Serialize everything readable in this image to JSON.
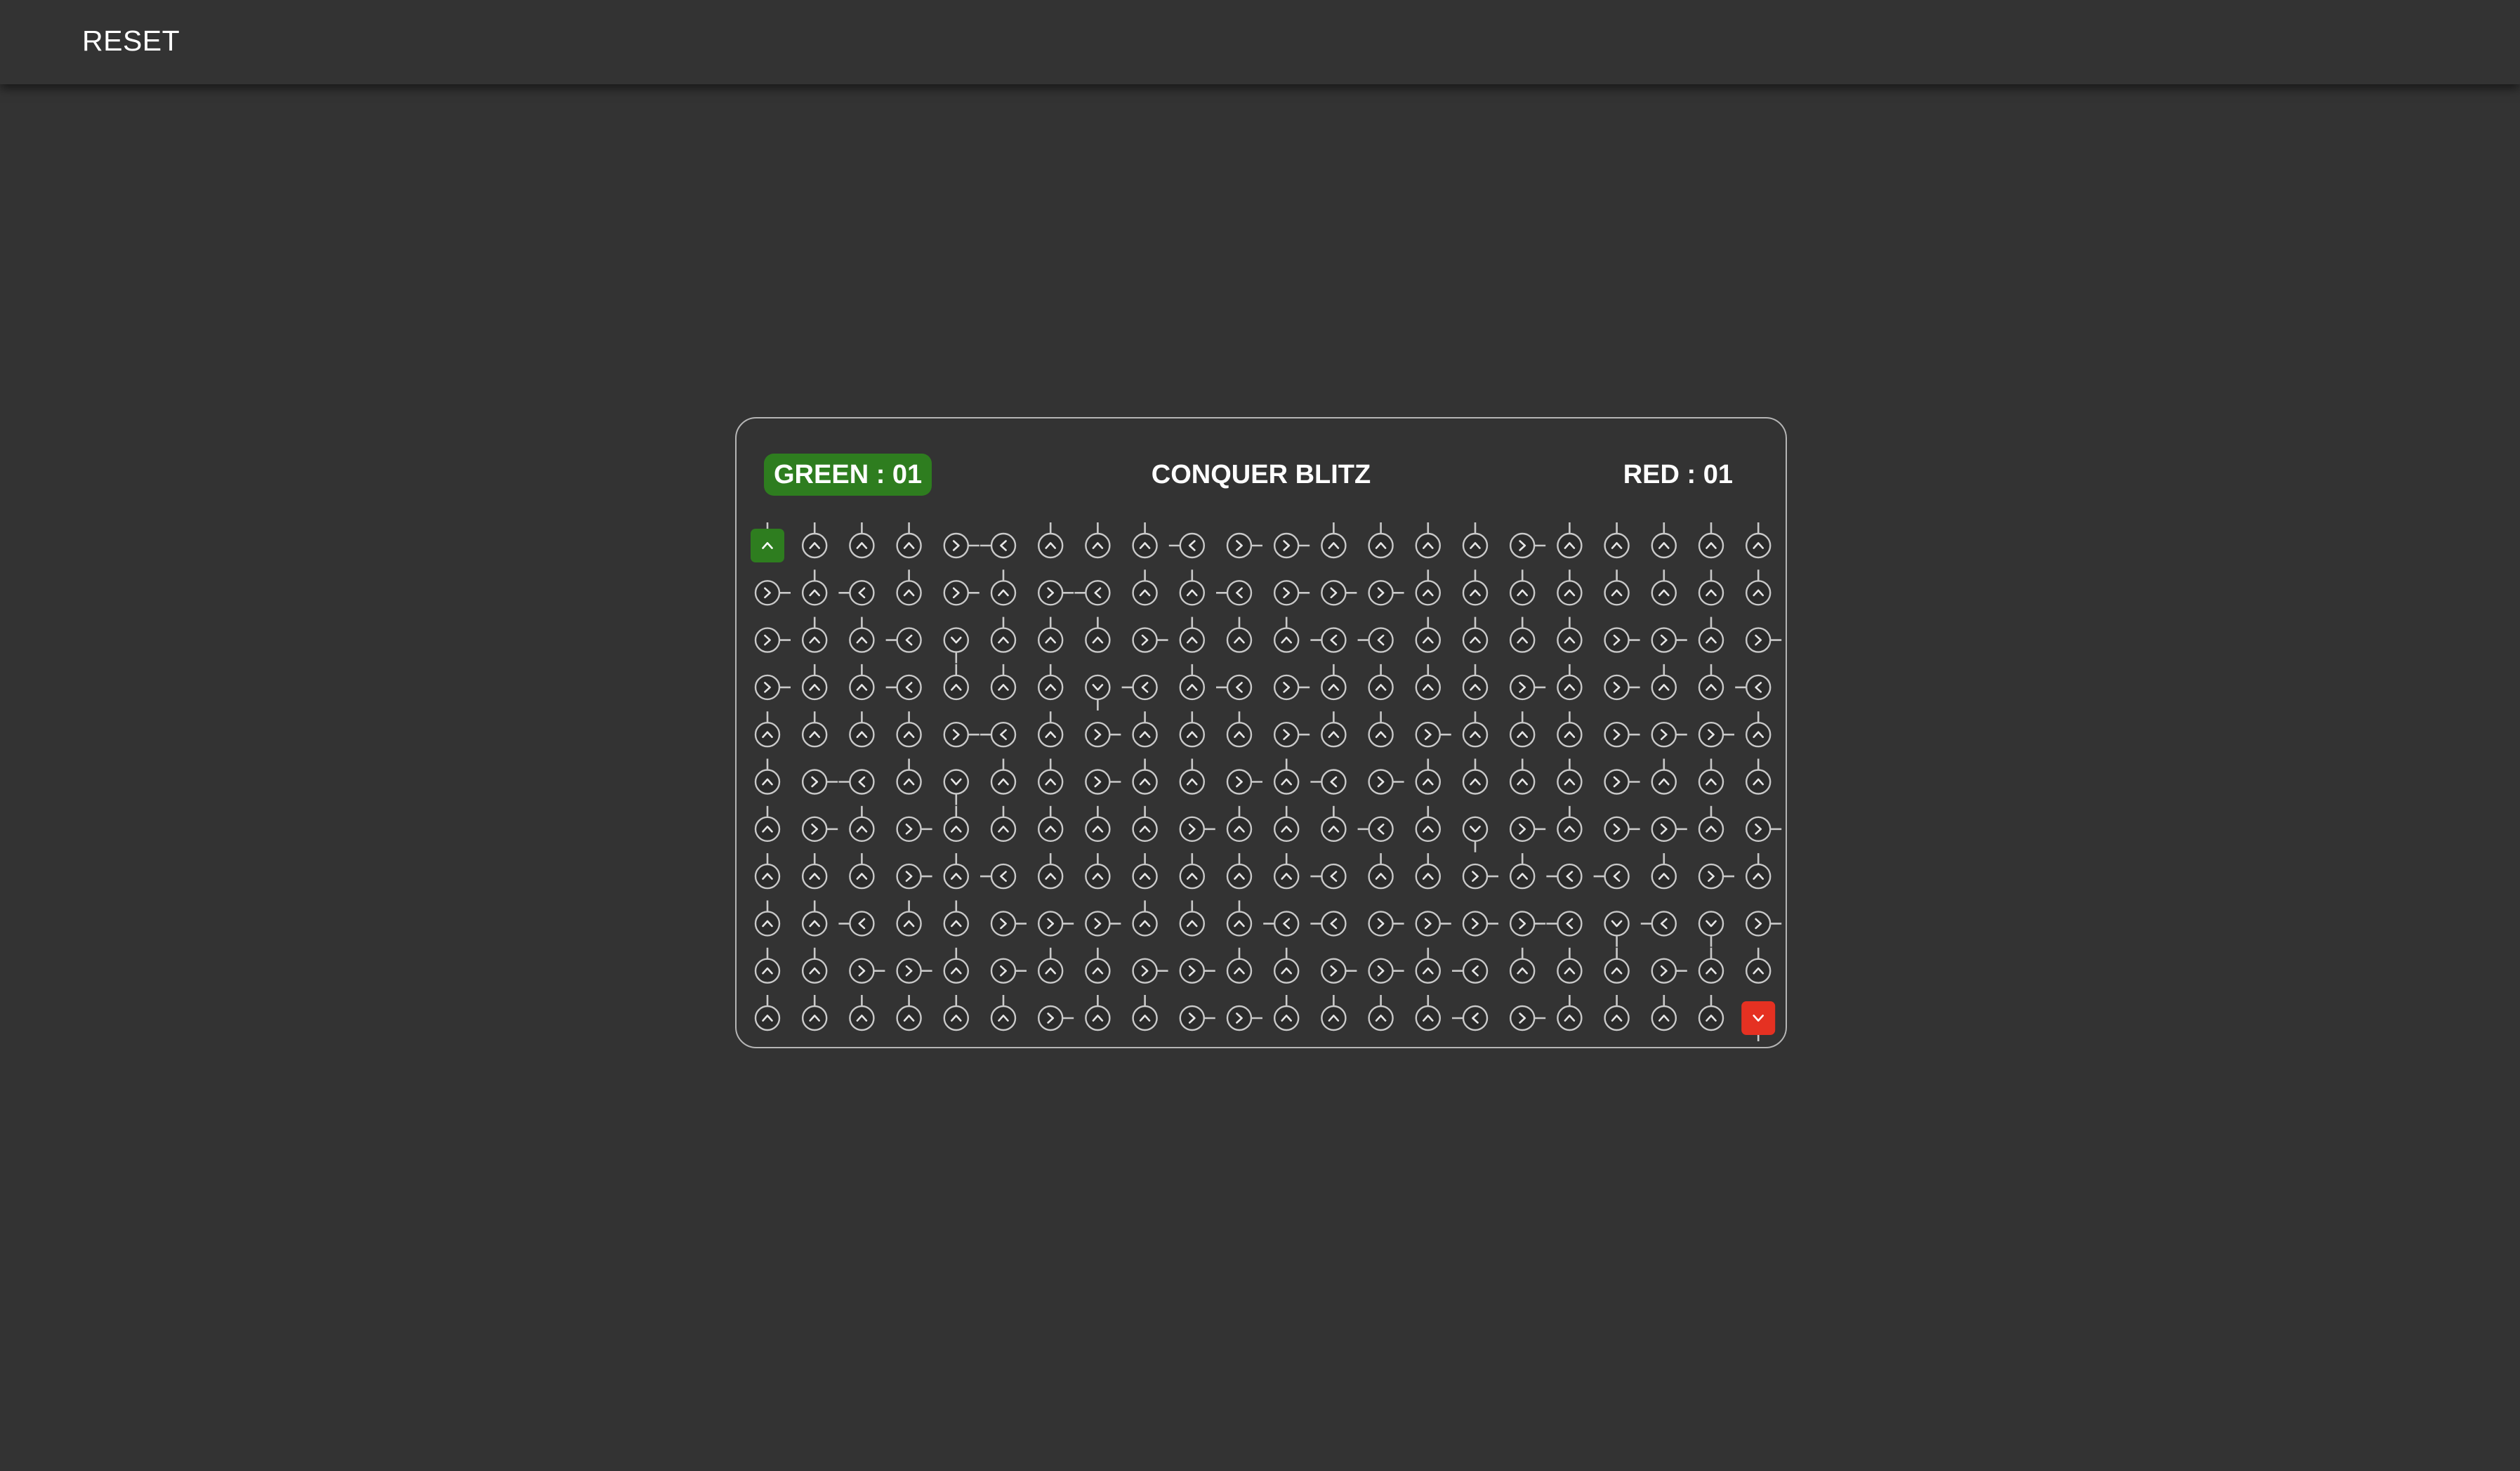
{
  "toolbar": {
    "reset_label": "RESET"
  },
  "game": {
    "title": "CONQUER BLITZ",
    "green_score": "GREEN : 01",
    "red_score": "RED : 01"
  },
  "colors": {
    "background": "#333333",
    "green_owner": "#2e7d1f",
    "red_owner": "#e53122",
    "node_stroke": "#c9c9c9",
    "panel_border": "#b5b5b5"
  },
  "legend": {
    "U": "up-arrow-icon",
    "D": "down-arrow-icon",
    "L": "left-arrow-icon",
    "R": "right-arrow-icon"
  },
  "board": {
    "columns": 22,
    "rows": [
      [
        "U",
        "U",
        "U",
        "U",
        "R",
        "L",
        "U",
        "U",
        "U",
        "L",
        "R",
        "R",
        "U",
        "U",
        "U",
        "U",
        "R",
        "U",
        "U",
        "U",
        "U",
        "U"
      ],
      [
        "R",
        "U",
        "L",
        "U",
        "R",
        "U",
        "R",
        "L",
        "U",
        "U",
        "L",
        "R",
        "R",
        "R",
        "U",
        "U",
        "U",
        "U",
        "U",
        "U",
        "U",
        "U"
      ],
      [
        "R",
        "U",
        "U",
        "L",
        "D",
        "U",
        "U",
        "U",
        "R",
        "U",
        "U",
        "U",
        "L",
        "L",
        "U",
        "U",
        "U",
        "U",
        "R",
        "R",
        "U",
        "R"
      ],
      [
        "R",
        "U",
        "U",
        "L",
        "U",
        "U",
        "U",
        "D",
        "L",
        "U",
        "L",
        "R",
        "U",
        "U",
        "U",
        "U",
        "R",
        "U",
        "R",
        "U",
        "U",
        "L"
      ],
      [
        "U",
        "U",
        "U",
        "U",
        "R",
        "L",
        "U",
        "R",
        "U",
        "U",
        "U",
        "R",
        "U",
        "U",
        "R",
        "U",
        "U",
        "U",
        "R",
        "R",
        "R",
        "U"
      ],
      [
        "U",
        "R",
        "L",
        "U",
        "D",
        "U",
        "U",
        "R",
        "U",
        "U",
        "R",
        "U",
        "L",
        "R",
        "U",
        "U",
        "U",
        "U",
        "R",
        "U",
        "U",
        "U"
      ],
      [
        "U",
        "R",
        "U",
        "R",
        "U",
        "U",
        "U",
        "U",
        "U",
        "R",
        "U",
        "U",
        "U",
        "L",
        "U",
        "D",
        "R",
        "U",
        "R",
        "R",
        "U",
        "R"
      ],
      [
        "U",
        "U",
        "U",
        "R",
        "U",
        "L",
        "U",
        "U",
        "U",
        "U",
        "U",
        "U",
        "L",
        "U",
        "U",
        "R",
        "U",
        "L",
        "L",
        "U",
        "R",
        "U"
      ],
      [
        "U",
        "U",
        "L",
        "U",
        "U",
        "R",
        "R",
        "R",
        "U",
        "U",
        "U",
        "L",
        "L",
        "R",
        "R",
        "R",
        "R",
        "L",
        "D",
        "L",
        "D",
        "R"
      ],
      [
        "U",
        "U",
        "R",
        "R",
        "U",
        "R",
        "U",
        "U",
        "R",
        "R",
        "U",
        "U",
        "R",
        "R",
        "U",
        "L",
        "U",
        "U",
        "U",
        "R",
        "U",
        "U"
      ],
      [
        "U",
        "U",
        "U",
        "U",
        "U",
        "U",
        "R",
        "U",
        "U",
        "R",
        "R",
        "U",
        "U",
        "U",
        "U",
        "L",
        "R",
        "U",
        "U",
        "U",
        "U",
        "D"
      ]
    ],
    "owners": [
      {
        "row": 0,
        "col": 0,
        "team": "green"
      },
      {
        "row": 10,
        "col": 21,
        "team": "red"
      }
    ]
  }
}
